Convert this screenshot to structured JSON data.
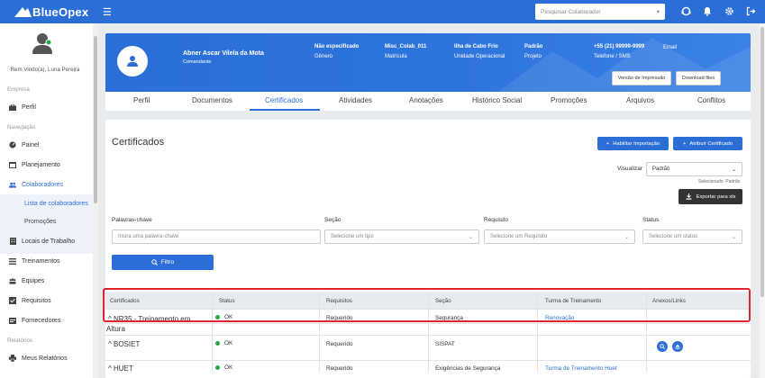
{
  "app": {
    "brand": "BlueOpex",
    "search_placeholder": "Pesquisar Colaborador"
  },
  "sidebar": {
    "welcome": "Rem Vindo(a), Luna Pereira",
    "section_empresa": "Empresa",
    "perfil": "Perfil",
    "section_navegacao": "Navegação",
    "items": [
      {
        "label": "Painel"
      },
      {
        "label": "Planejamento"
      },
      {
        "label": "Colaboradores"
      },
      {
        "label": "Locais de Trabalho"
      },
      {
        "label": "Treinamentos"
      },
      {
        "label": "Equipes"
      },
      {
        "label": "Requisitos"
      },
      {
        "label": "Fornecedores"
      }
    ],
    "sub_items": [
      {
        "label": "Lista de colaboradores"
      },
      {
        "label": "Promoções"
      }
    ],
    "section_relatorios": "Relatórios",
    "meus_relatorios": "Meus Relatórios"
  },
  "profile": {
    "name": "Abner Ascar Vilela da Mota",
    "role": "Comandante",
    "fields": [
      {
        "value": "Não especificado",
        "label": "Gênero"
      },
      {
        "value": "Misc_Colab_011",
        "label": "Matrícula"
      },
      {
        "value": "Ilha de Cabo Frio",
        "label": "Unidade Operacional"
      },
      {
        "value": "Padrão",
        "label": "Projeto"
      },
      {
        "value": "+55 (21) 99999-9999",
        "label": "Telefone / SMS"
      },
      {
        "value": "Email",
        "label": ""
      }
    ],
    "btn_print": "Versão de Impressão",
    "btn_download": "Download files"
  },
  "tabs": [
    "Perfil",
    "Documentos",
    "Certificados",
    "Atividades",
    "Anotações",
    "Histórico Social",
    "Promoções",
    "Arquivos",
    "Conflitos"
  ],
  "certificados": {
    "title": "Certificados",
    "btn_import": "Habilitar Importação",
    "btn_assign": "Atribuir Certificado",
    "visualizar_label": "Visualizar",
    "visualizar_value": "Padrão",
    "selecionado": "Selecionado: Padrão",
    "btn_export": "Exportar para xls",
    "filters": {
      "keywords_label": "Palavras-chave",
      "keywords_placeholder": "Insira uma palavra-chave",
      "secao_label": "Seção",
      "secao_placeholder": "Selecione um tipo",
      "requisito_label": "Requisito",
      "requisito_placeholder": "Selecione um Requisito",
      "status_label": "Status",
      "status_placeholder": "Selecione um status",
      "btn_filter": "Filtro"
    },
    "table": {
      "headers": [
        "Certificados",
        "Status",
        "Requisitos",
        "Seção",
        "Turma de Treinamento",
        "Anexos/Links"
      ],
      "rows": [
        {
          "name_line1": "NR35 - Treinamento em",
          "name_line2": "Altura",
          "status": "OK",
          "requisito": "Requerido",
          "secao": "Segurança",
          "turma": "Renovação"
        },
        {
          "name_line1": "BOSIET",
          "name_line2": "",
          "status": "OK",
          "requisito": "Requerido",
          "secao": "SISPAT",
          "turma": ""
        },
        {
          "name_line1": "HUET",
          "name_line2": "",
          "status": "OK",
          "requisito": "Requerido",
          "secao": "Exigências de Segurança",
          "turma": "Turma de Treinamento Huet"
        }
      ]
    }
  },
  "colors": {
    "primary": "#2b6fd6",
    "ok": "#28a745",
    "highlight": "#e0262b"
  }
}
